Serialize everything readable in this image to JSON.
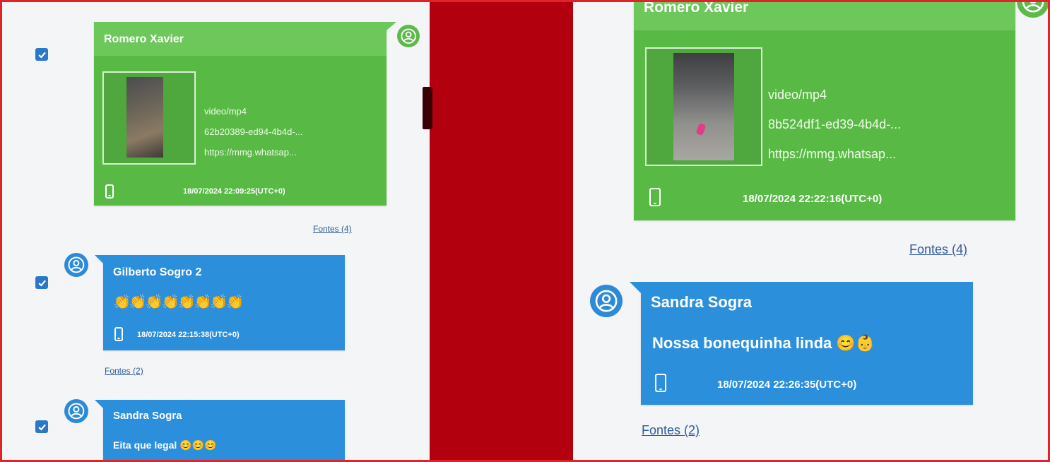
{
  "left_panel": {
    "video_message": {
      "sender": "Romero Xavier",
      "mime": "video/mp4",
      "file_id": "62b20389-ed94-4b4d-...",
      "url": "https://mmg.whatsap...",
      "timestamp": "18/07/2024 22:09:25(UTC+0)",
      "sources": "Fontes (4)"
    },
    "message_2": {
      "sender": "Gilberto Sogro 2",
      "text": "👏👏👏👏👏👏👏👏",
      "timestamp": "18/07/2024 22:15:38(UTC+0)",
      "sources": "Fontes (2)"
    },
    "message_3": {
      "sender": "Sandra Sogra",
      "text": "Eita que legal 😊😊😊"
    }
  },
  "right_panel": {
    "video_message": {
      "sender": "Romero Xavier",
      "mime": "video/mp4",
      "file_id": "8b524df1-ed39-4b4d-...",
      "url": "https://mmg.whatsap...",
      "timestamp": "18/07/2024 22:22:16(UTC+0)",
      "sources": "Fontes (4)"
    },
    "message_2": {
      "sender": "Sandra Sogra",
      "text": "Nossa bonequinha linda 😊👶",
      "timestamp": "18/07/2024 22:26:35(UTC+0)",
      "sources": "Fontes (2)"
    }
  },
  "colors": {
    "frame_border": "#e0232b",
    "divider": "#b3000f",
    "outgoing_bubble": "#58b945",
    "incoming_bubble": "#2b8fdc",
    "checkbox": "#2a78c8",
    "link": "#2f5c9c"
  }
}
